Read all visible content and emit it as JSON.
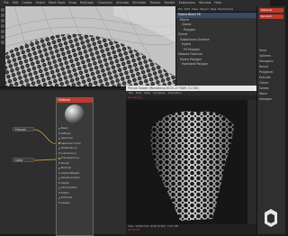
{
  "main_menu": [
    "File",
    "Edit",
    "Create",
    "Select",
    "Mesh Tools",
    "Snap",
    "MoGraph",
    "Character",
    "Animate",
    "Simulate",
    "Tracker",
    "Render",
    "Extensions",
    "Window",
    "Help"
  ],
  "objects": {
    "tabs": [
      "File",
      "Edit",
      "View",
      "Object",
      "Tags",
      "Bookmarks"
    ],
    "items": [
      "Hydra Block Fit",
      "Macro",
      "Cloner",
      "Polygon",
      "Cloner",
      "Subdivision Surface",
      "Hydra",
      "Fit Polygon",
      "Voronoi Fracture",
      "Hydra Polygon",
      "Hydrated Polygon"
    ]
  },
  "right_panel": {
    "buttons": [
      "Material",
      "Random"
    ],
    "items": [
      "Hexa",
      "Spheres",
      "Hexagons",
      "Round",
      "Polygonal",
      "Extrude",
      "Cloner",
      "Sweep",
      "Wave",
      "Hexagon"
    ]
  },
  "node_editor": {
    "nodes": [
      "Fresnel",
      "Color"
    ],
    "material": {
      "name": "Material",
      "ports": [
        "Basic",
        "Diffuse",
        "Specular",
        "Specular Color",
        "Reflectance",
        "Luminance",
        "Transparency",
        "Bump",
        "Normal",
        "Alpha Weight",
        "Displacement",
        "Alpha",
        "Illumination",
        "Editor",
        "Extrude",
        "Assign"
      ],
      "active_ports": [
        3,
        6
      ]
    }
  },
  "render_window": {
    "title": "Picture Viewer (Rendering 00:01:27 RAM: 3.3 GB)",
    "menu": [
      "File",
      "Edit",
      "View",
      "Compare",
      "Animation"
    ],
    "subline": "Rendering..."
  },
  "status": {
    "line1": "Size: 1280x720, RGB (8 Bit), 3.97 MB",
    "line2": "00:01:27"
  },
  "colors": {
    "accent": "#c0392b",
    "selection": "#3a4a66",
    "wire": "#e3b23c"
  }
}
